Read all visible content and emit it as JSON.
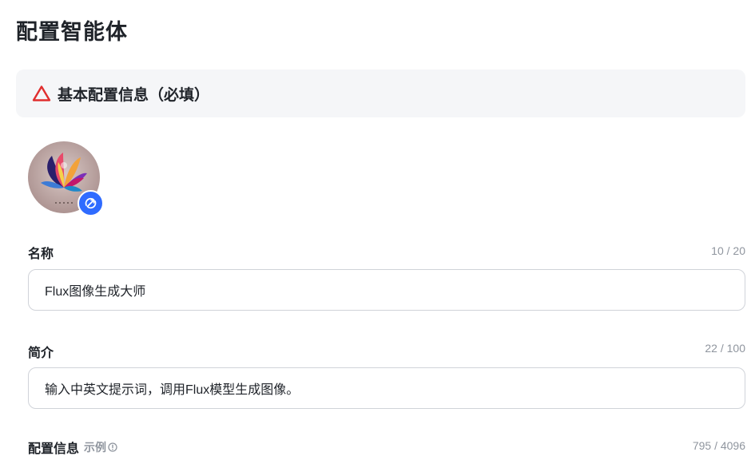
{
  "page": {
    "title": "配置智能体"
  },
  "section": {
    "title": "基本配置信息（必填）",
    "icon": "warning-triangle-icon",
    "accent": "#e02e2e"
  },
  "avatar": {
    "badge_icon": "edit-refresh-icon",
    "badge_color": "#2f6bff"
  },
  "fields": {
    "name": {
      "label": "名称",
      "value": "Flux图像生成大师",
      "counter": "10 / 20"
    },
    "intro": {
      "label": "简介",
      "value": "输入中英文提示词，调用Flux模型生成图像。",
      "counter": "22 / 100"
    },
    "config": {
      "label": "配置信息",
      "example_label": "示例",
      "counter": "795 / 4096"
    }
  }
}
